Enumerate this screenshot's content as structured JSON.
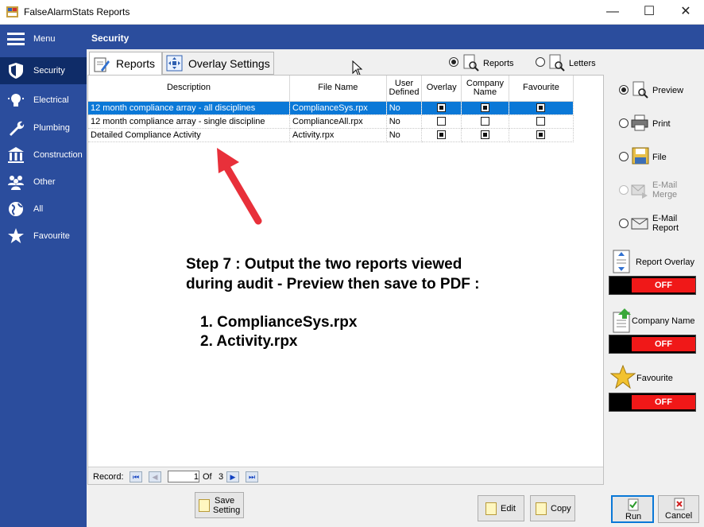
{
  "window": {
    "title": "FalseAlarmStats Reports",
    "min": "—",
    "max": "☐",
    "close": "✕"
  },
  "sidebar": {
    "menu_label": "Menu",
    "items": [
      {
        "label": "Security",
        "icon": "shield-icon"
      },
      {
        "label": "Electrical",
        "icon": "lightbulb-icon"
      },
      {
        "label": "Plumbing",
        "icon": "wrench-icon"
      },
      {
        "label": "Construction",
        "icon": "building-icon"
      },
      {
        "label": "Other",
        "icon": "people-icon"
      },
      {
        "label": "All",
        "icon": "globe-icon"
      },
      {
        "label": "Favourite",
        "icon": "star-icon"
      }
    ]
  },
  "section_title": "Security",
  "tabs": {
    "reports": "Reports",
    "overlay": "Overlay Settings"
  },
  "mode": {
    "reports": "Reports",
    "letters": "Letters"
  },
  "grid": {
    "headers": {
      "description": "Description",
      "file": "File Name",
      "user_defined_1": "User",
      "user_defined_2": "Defined",
      "overlay": "Overlay",
      "company_1": "Company",
      "company_2": "Name",
      "favourite": "Favourite"
    },
    "rows": [
      {
        "description": "12 month compliance array - all disciplines",
        "file": "ComplianceSys.rpx",
        "user_defined": "No",
        "overlay": true,
        "company": true,
        "favourite": true
      },
      {
        "description": "12 month compliance array - single discipline",
        "file": "ComplianceAll.rpx",
        "user_defined": "No",
        "overlay": false,
        "company": false,
        "favourite": false
      },
      {
        "description": "Detailed Compliance Activity",
        "file": "Activity.rpx",
        "user_defined": "No",
        "overlay": true,
        "company": true,
        "favourite": true
      }
    ]
  },
  "navigator": {
    "record_label": "Record:",
    "current": "1",
    "of_label": "Of",
    "total": "3"
  },
  "annotation": {
    "line1": "Step 7 : Output the two reports viewed",
    "line2": "during audit - Preview then save to PDF :",
    "item1": "1. ComplianceSys.rpx",
    "item2": "2.  Activity.rpx",
    "arrow_color": "#e8303a"
  },
  "output": {
    "preview": "Preview",
    "print": "Print",
    "file": "File",
    "email_merge_1": "E-Mail",
    "email_merge_2": "Merge",
    "email_report_1": "E-Mail",
    "email_report_2": "Report"
  },
  "toggles": {
    "report_overlay": {
      "label": "Report Overlay",
      "state": "OFF"
    },
    "company_name": {
      "label": "Company Name",
      "state": "OFF"
    },
    "favourite": {
      "label": "Favourite",
      "state": "OFF"
    }
  },
  "buttons": {
    "save_1": "Save",
    "save_2": "Setting",
    "edit": "Edit",
    "copy": "Copy",
    "run": "Run",
    "cancel": "Cancel"
  },
  "colors": {
    "sidebar": "#2b4d9d",
    "sidebar_active": "#0f2c68",
    "selection": "#0a78d7",
    "toggle_off": "#f01818"
  }
}
